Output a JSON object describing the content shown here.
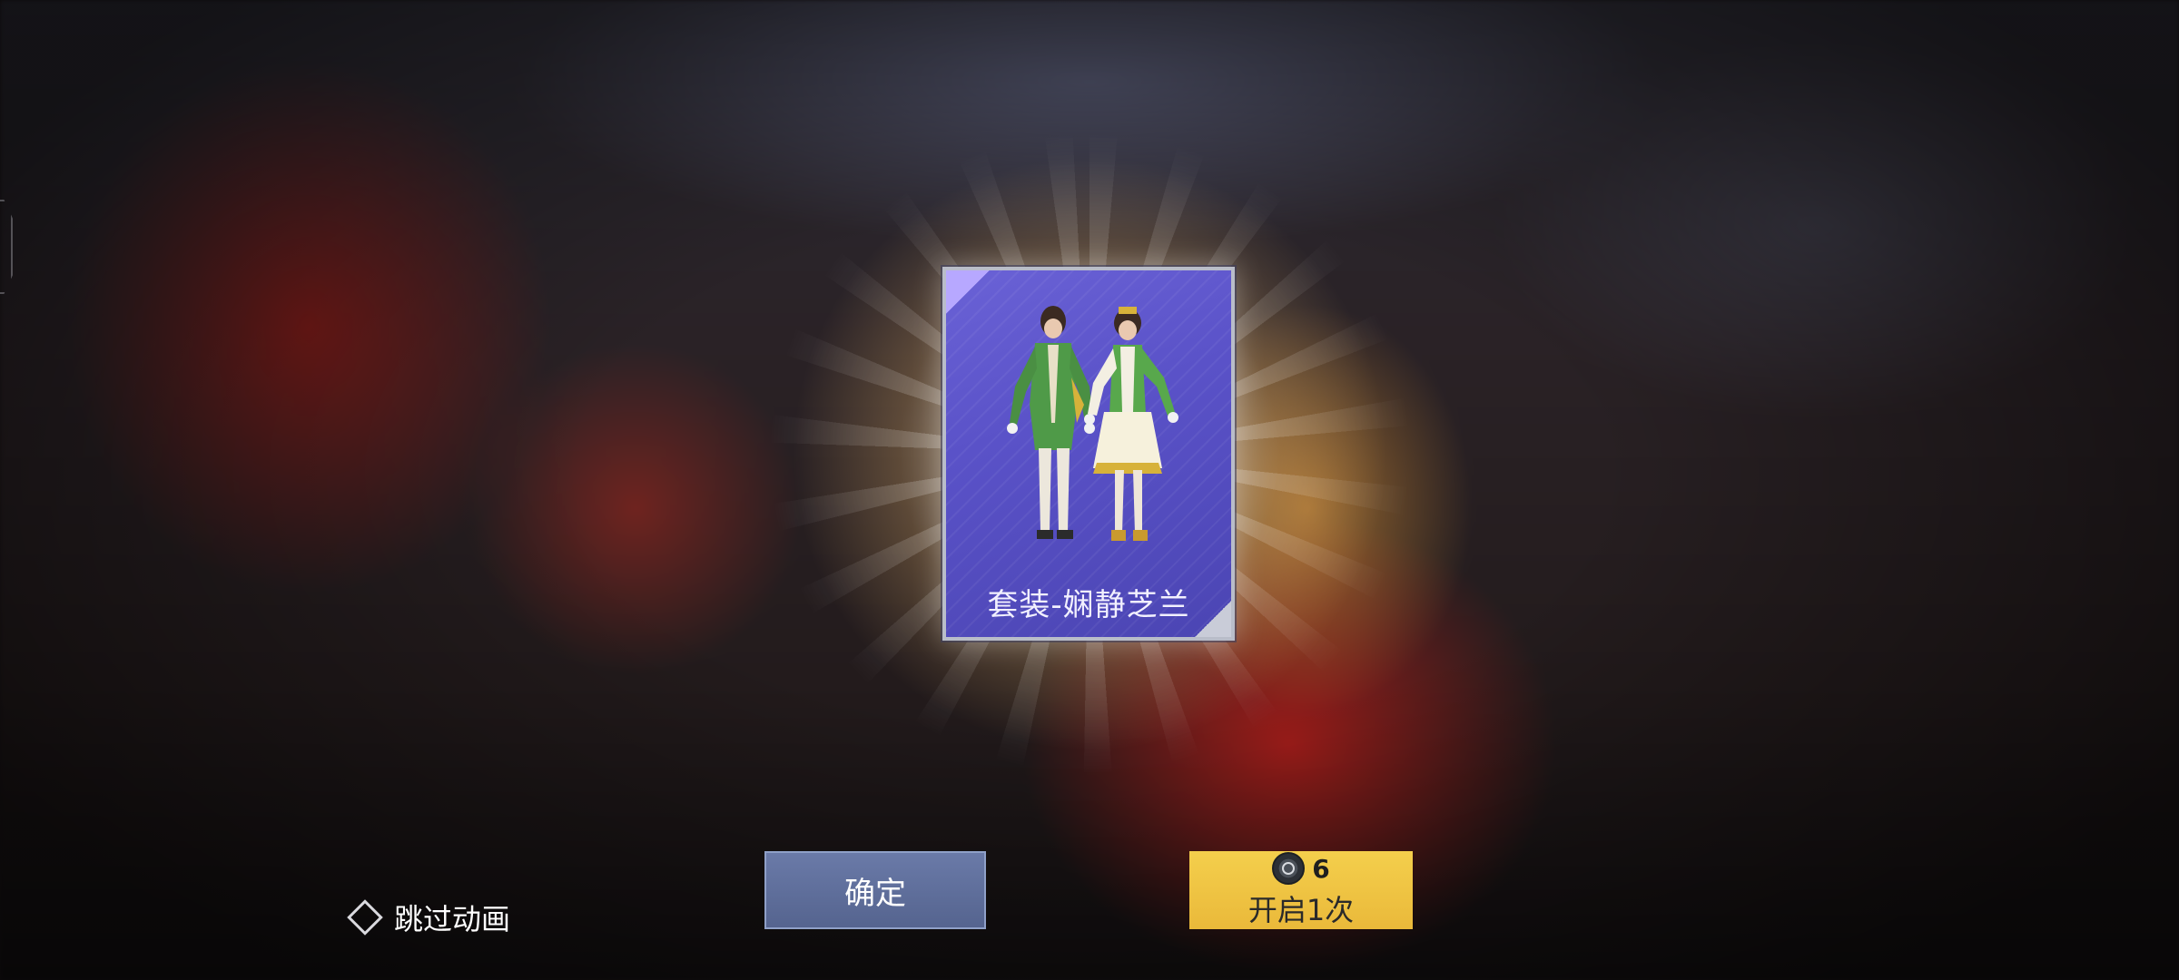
{
  "reward": {
    "item_name": "套装-娴静芝兰"
  },
  "controls": {
    "skip_label": "跳过动画",
    "confirm_label": "确定",
    "open_cost": "6",
    "open_label": "开启1次"
  },
  "colors": {
    "card_purple": "#5a52c8",
    "confirm_blue": "#5b6b98",
    "open_yellow": "#f0c545"
  }
}
